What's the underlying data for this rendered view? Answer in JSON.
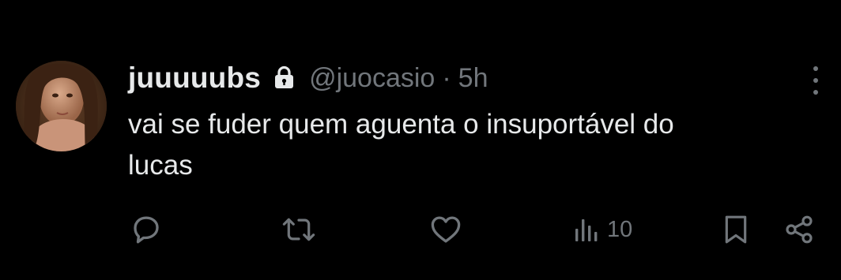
{
  "tweet": {
    "display_name": "juuuuubs",
    "handle": "@juocasio",
    "separator": "·",
    "time": "5h",
    "text_line1": "vai se fuder quem aguenta o insuportável do",
    "text_line2": "lucas"
  },
  "actions": {
    "views_count": "10"
  },
  "icons": {
    "lock": "lock-icon",
    "more": "more-vertical-icon",
    "reply": "reply-icon",
    "retweet": "retweet-icon",
    "like": "heart-icon",
    "views": "views-bars-icon",
    "bookmark": "bookmark-icon",
    "share": "share-icon"
  },
  "colors": {
    "background": "#000000",
    "primary_text": "#e7e9ea",
    "secondary_text": "#71767b"
  }
}
